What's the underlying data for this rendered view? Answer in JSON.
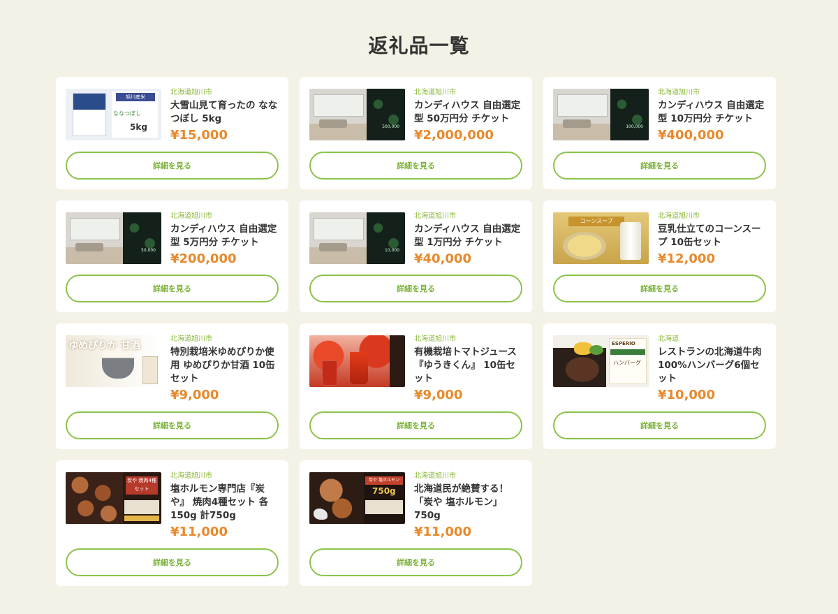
{
  "page": {
    "title": "返礼品一覧"
  },
  "button_label": "詳細を見る",
  "colors": {
    "accent_green": "#8bc34a",
    "price_orange": "#e8892b",
    "background": "#f4f2e6"
  },
  "items": [
    {
      "region": "北海道旭川市",
      "name": "大雪山見て育ったの ななつぼし 5kg",
      "price": "¥15,000",
      "image": "rice-bag",
      "image_text": {
        "label": "旭川産米",
        "name": "ななつぼし",
        "weight": "5kg"
      }
    },
    {
      "region": "北海道旭川市",
      "name": "カンディハウス 自由選定型 50万円分 チケット",
      "price": "¥2,000,000",
      "image": "interior-ticket",
      "image_text": {
        "value": "500,000"
      }
    },
    {
      "region": "北海道旭川市",
      "name": "カンディハウス 自由選定型 10万円分 チケット",
      "price": "¥400,000",
      "image": "interior-ticket",
      "image_text": {
        "value": "100,000"
      }
    },
    {
      "region": "北海道旭川市",
      "name": "カンディハウス 自由選定型 5万円分 チケット",
      "price": "¥200,000",
      "image": "interior-ticket",
      "image_text": {
        "value": "50,000"
      }
    },
    {
      "region": "北海道旭川市",
      "name": "カンディハウス 自由選定型 1万円分 チケット",
      "price": "¥40,000",
      "image": "interior-ticket",
      "image_text": {
        "value": "10,000"
      }
    },
    {
      "region": "北海道旭川市",
      "name": "豆乳仕立てのコーンスープ 10缶セット",
      "price": "¥12,000",
      "image": "corn-soup",
      "image_text": {
        "band": "コーンスープ"
      }
    },
    {
      "region": "北海道旭川市",
      "name": "特別栽培米ゆめぴりか使用 ゆめぴりか甘酒 10缶セット",
      "price": "¥9,000",
      "image": "amazake",
      "image_text": {
        "main": "ゆめぴりか 甘酒"
      }
    },
    {
      "region": "北海道旭川市",
      "name": "有機栽培トマトジュース『ゆうきくん』 10缶セット",
      "price": "¥9,000",
      "image": "tomato-juice",
      "image_text": {}
    },
    {
      "region": "北海道",
      "name": "レストランの北海道牛肉100%ハンバーグ6個セット",
      "price": "¥10,000",
      "image": "hamburger",
      "image_text": {
        "brand": "ESPERIO",
        "product": "ハンバーグ"
      }
    },
    {
      "region": "北海道旭川市",
      "name": "塩ホルモン専門店『炭や』 焼肉4種セット 各150g 計750g",
      "price": "¥11,000",
      "image": "horumon-set",
      "image_text": {
        "sign": "炭や 焼肉4種セット"
      }
    },
    {
      "region": "北海道旭川市",
      "name": "北海道民が絶賛する！「炭や 塩ホルモン」750g",
      "price": "¥11,000",
      "image": "horumon",
      "image_text": {
        "sign": "炭や 塩ホルモン",
        "amount": "750g"
      }
    }
  ]
}
